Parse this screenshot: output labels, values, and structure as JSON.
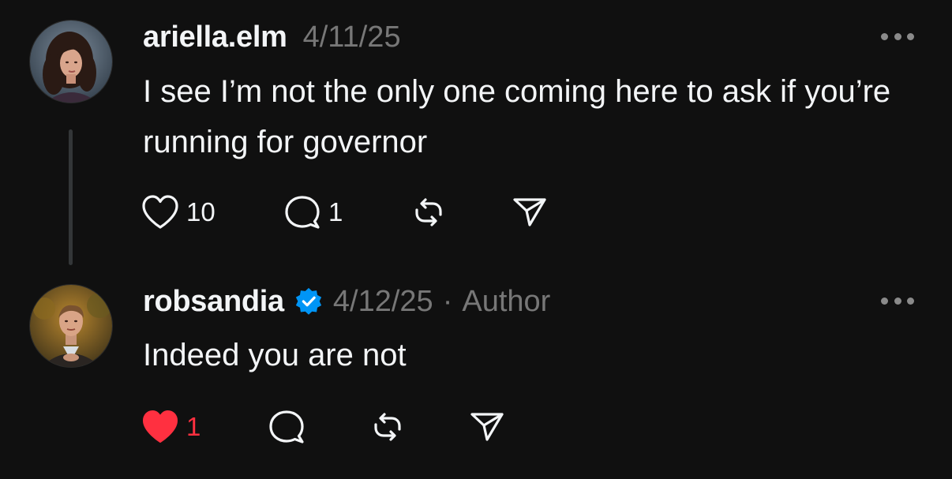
{
  "posts": [
    {
      "username": "ariella.elm",
      "verified": false,
      "date": "4/11/25",
      "text": "I see I’m not the only one coming here to ask if you’re running for governor",
      "likes": "10",
      "liked": false,
      "replies": "1",
      "icons": [
        "heart-icon",
        "comment-icon",
        "repost-icon",
        "share-icon",
        "more-icon"
      ]
    },
    {
      "username": "robsandia",
      "verified": true,
      "date": "4/12/25",
      "separator": "·",
      "author_label": "Author",
      "text": "Indeed you are not",
      "likes": "1",
      "liked": true,
      "icons": [
        "heart-filled-icon",
        "comment-icon",
        "repost-icon",
        "share-icon",
        "more-icon",
        "verified-badge-icon"
      ]
    }
  ],
  "colors": {
    "background": "#101010",
    "primary_text": "#f3f5f7",
    "secondary_text": "#777777",
    "like_red": "#ff3040",
    "verified_blue": "#0095f6",
    "thread_line": "#333638"
  }
}
